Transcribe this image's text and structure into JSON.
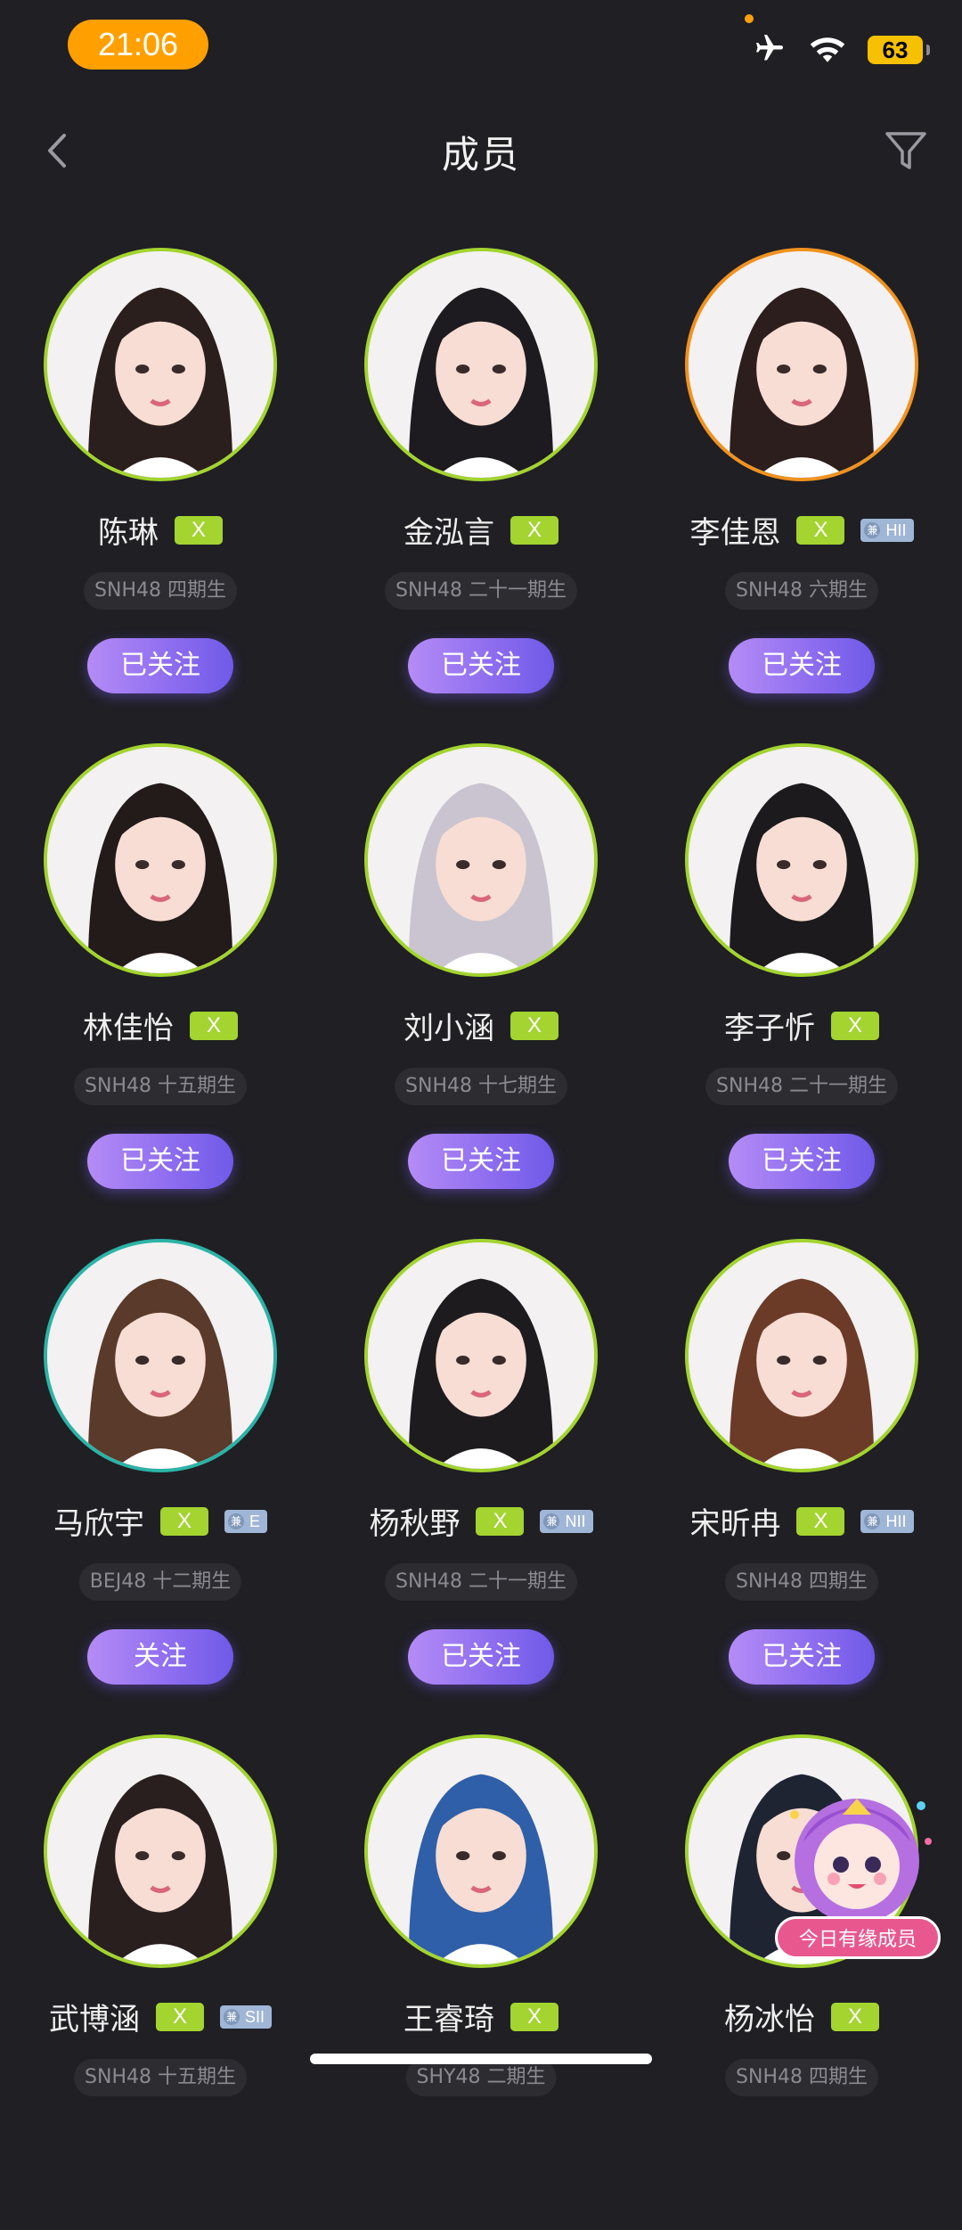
{
  "status_bar": {
    "time": "21:06",
    "battery": "63"
  },
  "nav": {
    "title": "成员"
  },
  "members": [
    {
      "name": "陈琳",
      "team": "X",
      "dual": "",
      "gen": "SNH48 四期生",
      "follow": "已关注",
      "ring": "green"
    },
    {
      "name": "金泓言",
      "team": "X",
      "dual": "",
      "gen": "SNH48 二十一期生",
      "follow": "已关注",
      "ring": "green"
    },
    {
      "name": "李佳恩",
      "team": "X",
      "dual": "HII",
      "gen": "SNH48 六期生",
      "follow": "已关注",
      "ring": "orange"
    },
    {
      "name": "林佳怡",
      "team": "X",
      "dual": "",
      "gen": "SNH48 十五期生",
      "follow": "已关注",
      "ring": "green"
    },
    {
      "name": "刘小涵",
      "team": "X",
      "dual": "",
      "gen": "SNH48 十七期生",
      "follow": "已关注",
      "ring": "green"
    },
    {
      "name": "李子忻",
      "team": "X",
      "dual": "",
      "gen": "SNH48 二十一期生",
      "follow": "已关注",
      "ring": "green"
    },
    {
      "name": "马欣宇",
      "team": "X",
      "dual": "E",
      "gen": "BEJ48 十二期生",
      "follow": "关注",
      "ring": "teal"
    },
    {
      "name": "杨秋野",
      "team": "X",
      "dual": "NII",
      "gen": "SNH48 二十一期生",
      "follow": "已关注",
      "ring": "green"
    },
    {
      "name": "宋昕冉",
      "team": "X",
      "dual": "HII",
      "gen": "SNH48 四期生",
      "follow": "已关注",
      "ring": "green"
    },
    {
      "name": "武博涵",
      "team": "X",
      "dual": "SII",
      "gen": "SNH48 十五期生",
      "follow": "",
      "ring": "green"
    },
    {
      "name": "王睿琦",
      "team": "X",
      "dual": "",
      "gen": "SHY48 二期生",
      "follow": "",
      "ring": "green"
    },
    {
      "name": "杨冰怡",
      "team": "X",
      "dual": "",
      "gen": "SNH48 四期生",
      "follow": "",
      "ring": "green"
    }
  ],
  "dual_prefix": "兼",
  "widget": {
    "label": "今日有缘成员"
  },
  "colors": {
    "background": "#1f1f24",
    "team_x": "#a3d42f",
    "follow_gradient": [
      "#b48cf6",
      "#6f5ae8"
    ],
    "ring_orange": "#f0921f",
    "ring_teal": "#2bb3a6"
  },
  "icons": {
    "back": "chevron-left-icon",
    "filter": "funnel-icon",
    "airplane": "airplane-icon",
    "wifi": "wifi-icon",
    "battery": "battery-icon"
  }
}
